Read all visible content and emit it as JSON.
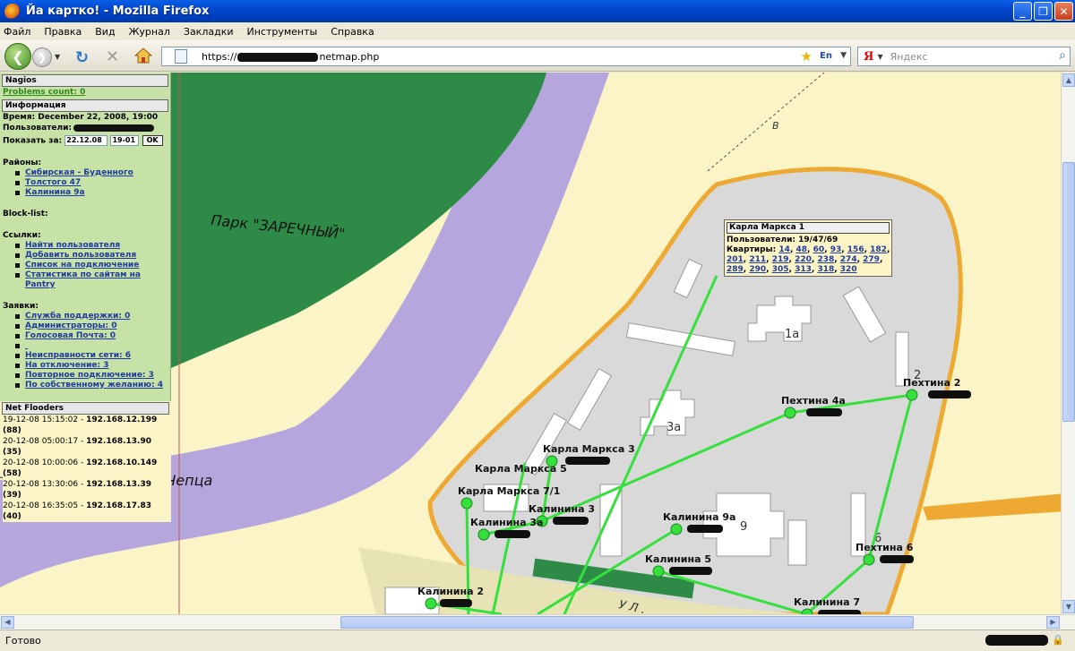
{
  "window": {
    "title": "Йа картко! - Mozilla Firefox",
    "min_glyph": "_",
    "max_glyph": "❐",
    "close_glyph": "✕"
  },
  "menu": [
    "Файл",
    "Правка",
    "Вид",
    "Журнал",
    "Закладки",
    "Инструменты",
    "Справка"
  ],
  "nav": {
    "url_prefix": "https://",
    "url_suffix": "netmap.php",
    "lang_badge": "En",
    "search_placeholder": "Яндекс",
    "search_engine_glyph": "Я"
  },
  "map": {
    "park_label": "Парк \"ЗАРЕЧНЫЙ\"",
    "river_label": "р. Чепца",
    "street_label": "У Л .",
    "compass_letter": "В",
    "building_labels": [
      "1а",
      "3а",
      "9",
      "2",
      "6"
    ]
  },
  "panel": {
    "nagios_title": "Nagios",
    "problems_link": "Problems count: 0",
    "info_title": "Информация",
    "time_label": "Время: December 22, 2008, 19:00",
    "users_label": "Пользователи:",
    "show_label": "Показать за:",
    "date_value": "22.12.08",
    "hour_value": "19-01",
    "ok_label": "OK",
    "districts_label": "Районы:",
    "districts": [
      "Сибирская - Буденного",
      "Толстого 47",
      "Калинина 9а"
    ],
    "blocklist_label": "Block-list:",
    "links_label": "Ссылки:",
    "links": [
      "Найти пользователя",
      "Добавить пользователя",
      "Список на подключение",
      "Статистика по сайтам на Pantry"
    ],
    "requests_label": "Заявки:",
    "requests": [
      "Служба поддержки: 0",
      "Администраторы: 0",
      "Голосовая Почта: 0",
      "",
      "Неисправности сети: 6",
      "На отключение: 3",
      "Повторное подключение: 3",
      "По собственному желанию: 4"
    ],
    "flooders_title": "Net Flooders",
    "flooders": [
      {
        "time": "19-12-08 15:15:02 -",
        "ip": "192.168.12.199",
        "count": "(88)"
      },
      {
        "time": "20-12-08 05:00:17 -",
        "ip": "192.168.13.90",
        "count": "(35)"
      },
      {
        "time": "20-12-08 10:00:06 -",
        "ip": "192.168.10.149",
        "count": "(58)"
      },
      {
        "time": "20-12-08 13:30:06 -",
        "ip": "192.168.13.39",
        "count": "(39)"
      },
      {
        "time": "20-12-08 16:35:05 -",
        "ip": "192.168.17.83",
        "count": "(40)"
      }
    ]
  },
  "popup": {
    "title": "Карла Маркса 1",
    "users": "Пользователи: 19/47/69",
    "flats_label": "Квартиры:",
    "flats": [
      "14",
      "48",
      "60",
      "93",
      "156",
      "182",
      "201",
      "211",
      "219",
      "220",
      "238",
      "274",
      "279",
      "289",
      "290",
      "305",
      "313",
      "318",
      "320"
    ]
  },
  "nodes": [
    {
      "name": "Пехтина 4а"
    },
    {
      "name": "Пехтина 2"
    },
    {
      "name": "Карла Маркса 3"
    },
    {
      "name": "Карла Маркса 5"
    },
    {
      "name": "Карла Маркса 7/1"
    },
    {
      "name": "Калинина 3"
    },
    {
      "name": "Калинина 3а"
    },
    {
      "name": "Калинина 9а"
    },
    {
      "name": "Калинина 5"
    },
    {
      "name": "Пехтина 6"
    },
    {
      "name": "Калинина 2"
    },
    {
      "name": "Калинина 7"
    }
  ],
  "status": {
    "text": "Готово"
  },
  "colors": {
    "map_bg": "#fbf4c7",
    "park": "#2e8b47",
    "river": "#b5a7de",
    "block": "#d9d9d9",
    "road": "#eda932",
    "link": "#35e03c",
    "panel": "#c7e2a6"
  }
}
